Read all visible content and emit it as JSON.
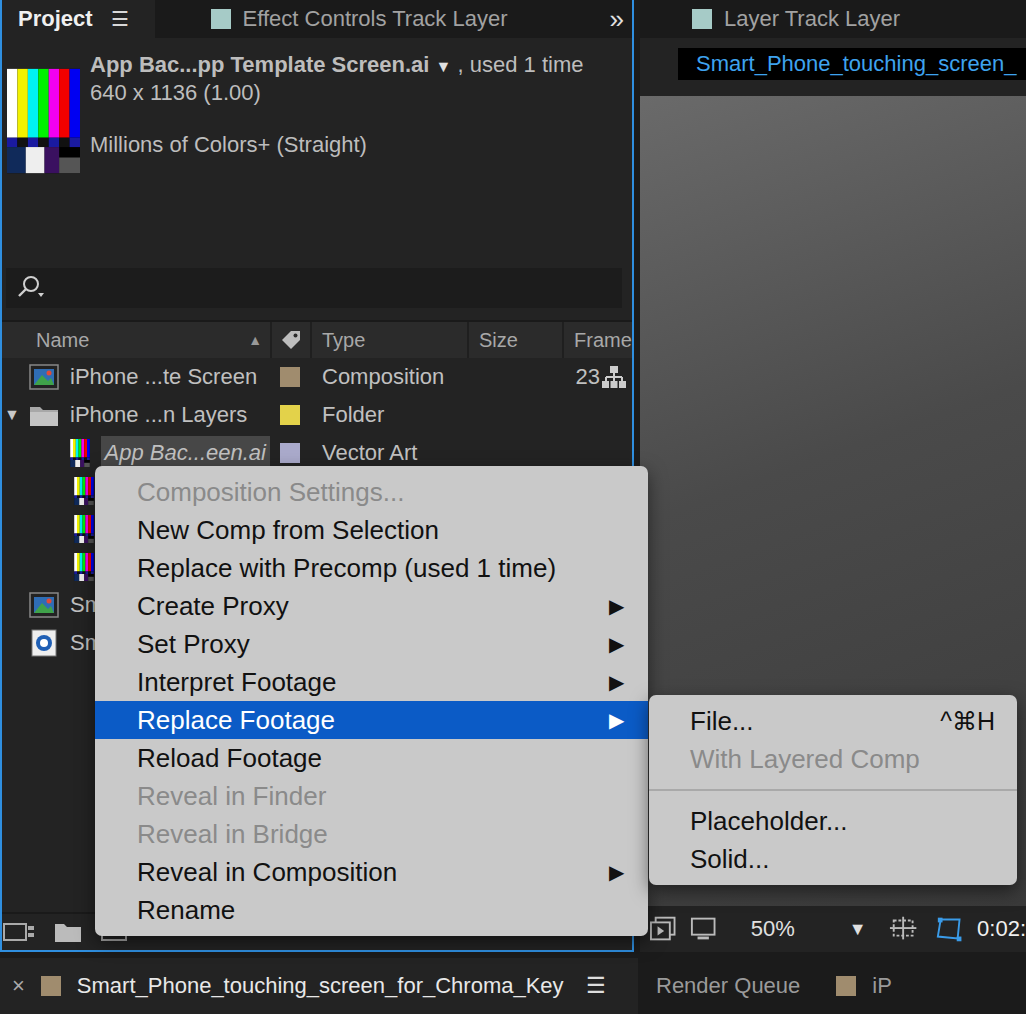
{
  "project_panel": {
    "tabs": [
      {
        "label": "Project",
        "menu": "☰",
        "selected": true,
        "color": "#1f1f1f"
      },
      {
        "label": "Effect Controls Track Layer",
        "selected": false,
        "color": "#a6cbc7"
      }
    ],
    "overflow": "»",
    "info": {
      "name": "App Bac...pp Template Screen.ai",
      "dropdown": "▼",
      "usage": ", used 1 time",
      "dimensions": "640 x 1136 (1.00)",
      "color_depth": "Millions of Colors+ (Straight)"
    },
    "columns": [
      {
        "label": "Name",
        "sort": "▲"
      },
      {
        "label": "Type"
      },
      {
        "label": "Size"
      },
      {
        "label": "Frame"
      }
    ],
    "rows": [
      {
        "name": "iPhone ...te Screen",
        "type": "Composition",
        "frame": "23",
        "kind": "comp",
        "color": "#a08c6e",
        "nested": false,
        "selected": false
      },
      {
        "name": "iPhone ...n Layers",
        "type": "Folder",
        "kind": "folder",
        "color": "#e3d24a",
        "nested": false,
        "twisty": "▼",
        "expanded": true,
        "selected": false
      },
      {
        "name": "App Bac...een.ai",
        "type": "Vector Art",
        "kind": "vector",
        "color": "#aaaacb",
        "nested": true,
        "selected": true
      },
      {
        "kind": "vector",
        "nested": true,
        "selected": false
      },
      {
        "kind": "vector",
        "nested": true,
        "selected": false
      },
      {
        "kind": "vector",
        "nested": true,
        "selected": false
      },
      {
        "name": "Sm",
        "kind": "comp",
        "nested": false,
        "selected": false
      },
      {
        "name": "Sm",
        "kind": "footage",
        "nested": false,
        "selected": false
      }
    ]
  },
  "viewer": {
    "tab": {
      "label": "Layer Track Layer",
      "color": "#a6cbc7"
    },
    "comp_tab": "Smart_Phone_touching_screen_",
    "zoom": "50%",
    "zoom_arrow": "▼",
    "timecode": "0:02:"
  },
  "context_menu": {
    "arrow": "▶",
    "items": [
      {
        "label": "Composition Settings...",
        "disabled": true,
        "submenu": false,
        "selected": false
      },
      {
        "label": "New Comp from Selection",
        "disabled": false,
        "submenu": false,
        "selected": false
      },
      {
        "label": "Replace with Precomp (used 1 time)",
        "disabled": false,
        "submenu": false,
        "selected": false
      },
      {
        "label": "Create Proxy",
        "disabled": false,
        "submenu": true,
        "selected": false
      },
      {
        "label": "Set Proxy",
        "disabled": false,
        "submenu": true,
        "selected": false
      },
      {
        "label": "Interpret Footage",
        "disabled": false,
        "submenu": true,
        "selected": false
      },
      {
        "label": "Replace Footage",
        "disabled": false,
        "submenu": true,
        "selected": true
      },
      {
        "label": "Reload Footage",
        "disabled": false,
        "submenu": false,
        "selected": false
      },
      {
        "label": "Reveal in Finder",
        "disabled": true,
        "submenu": false,
        "selected": false
      },
      {
        "label": "Reveal in Bridge",
        "disabled": true,
        "submenu": false,
        "selected": false
      },
      {
        "label": "Reveal in Composition",
        "disabled": false,
        "submenu": true,
        "selected": false
      },
      {
        "label": "Rename",
        "disabled": false,
        "submenu": false,
        "selected": false
      }
    ],
    "submenu": [
      {
        "kind": "item",
        "label": "File...",
        "shortcut": "^⌘H",
        "disabled": false
      },
      {
        "kind": "item",
        "label": "With Layered Comp",
        "disabled": true
      },
      {
        "kind": "separator"
      },
      {
        "kind": "item",
        "label": "Placeholder...",
        "disabled": false
      },
      {
        "kind": "item",
        "label": "Solid...",
        "disabled": false
      }
    ]
  },
  "bottom_tabs": [
    {
      "close": "×",
      "label": "Smart_Phone_touching_screen_for_Chroma_Key",
      "menu": "☰",
      "selected": true,
      "color": "#a08c6e"
    },
    {
      "label": "Render Queue",
      "selected": false
    },
    {
      "label": "iP",
      "selected": false,
      "color": "#a08c6e"
    }
  ]
}
